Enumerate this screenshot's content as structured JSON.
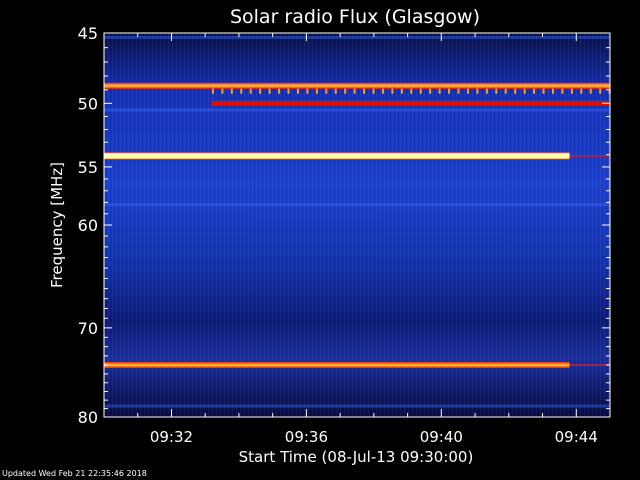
{
  "chart_data": {
    "type": "heatmap",
    "title": "Solar radio Flux (Glasgow)",
    "ylabel": "Frequency [MHz]",
    "xlabel": "Start Time (08-Jul-13 09:30:00)",
    "ylim": [
      80,
      45
    ],
    "yscale": "log",
    "y_ticks": [
      45,
      50,
      55,
      60,
      70,
      80
    ],
    "x_ticks": [
      "09:32",
      "09:36",
      "09:40",
      "09:44"
    ],
    "x_tick_minutes": [
      2,
      6,
      10,
      14
    ],
    "x_range_minutes": [
      0,
      15
    ],
    "bright_bands": [
      {
        "freq_mhz": 48.7,
        "intensity": "high",
        "start_min": 0,
        "end_min": 15
      },
      {
        "freq_mhz": 54.1,
        "intensity": "saturated",
        "start_min": 0,
        "end_min": 13.8
      },
      {
        "freq_mhz": 74.0,
        "intensity": "high",
        "start_min": 0,
        "end_min": 13.8
      },
      {
        "freq_mhz": 50.0,
        "intensity": "medium",
        "start_min": 3.2,
        "end_min": 15
      }
    ],
    "faint_bands_mhz": [
      45.3,
      50.5,
      58.2,
      78.7
    ]
  },
  "footer": "Updated Wed Feb 21 22:35:46 2018",
  "colors": {
    "background": "#000000",
    "spectrum_low": "#050540",
    "spectrum_mid": "#1030c0",
    "band_hot": "#ff2000",
    "band_core": "#ffffa0"
  }
}
